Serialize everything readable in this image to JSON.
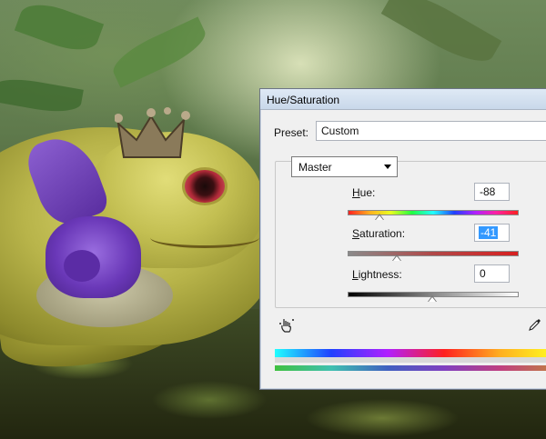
{
  "dialog": {
    "title": "Hue/Saturation",
    "preset_label": "Preset:",
    "preset_value": "Custom",
    "channel": "Master"
  },
  "adjustments": {
    "hue": {
      "label_accel": "H",
      "label_rest": "ue:",
      "value": "-88",
      "level": -88
    },
    "saturation": {
      "label_accel": "S",
      "label_rest": "aturation:",
      "value": "-41",
      "level": -41
    },
    "lightness": {
      "label_accel": "L",
      "label_rest": "ightness:",
      "value": "0",
      "level": 0
    }
  },
  "icons": {
    "targeted_adjust": "hand-pointer-icon",
    "eyedropper": "eyedropper-icon",
    "channel_dropdown": "chevron-down-icon"
  }
}
